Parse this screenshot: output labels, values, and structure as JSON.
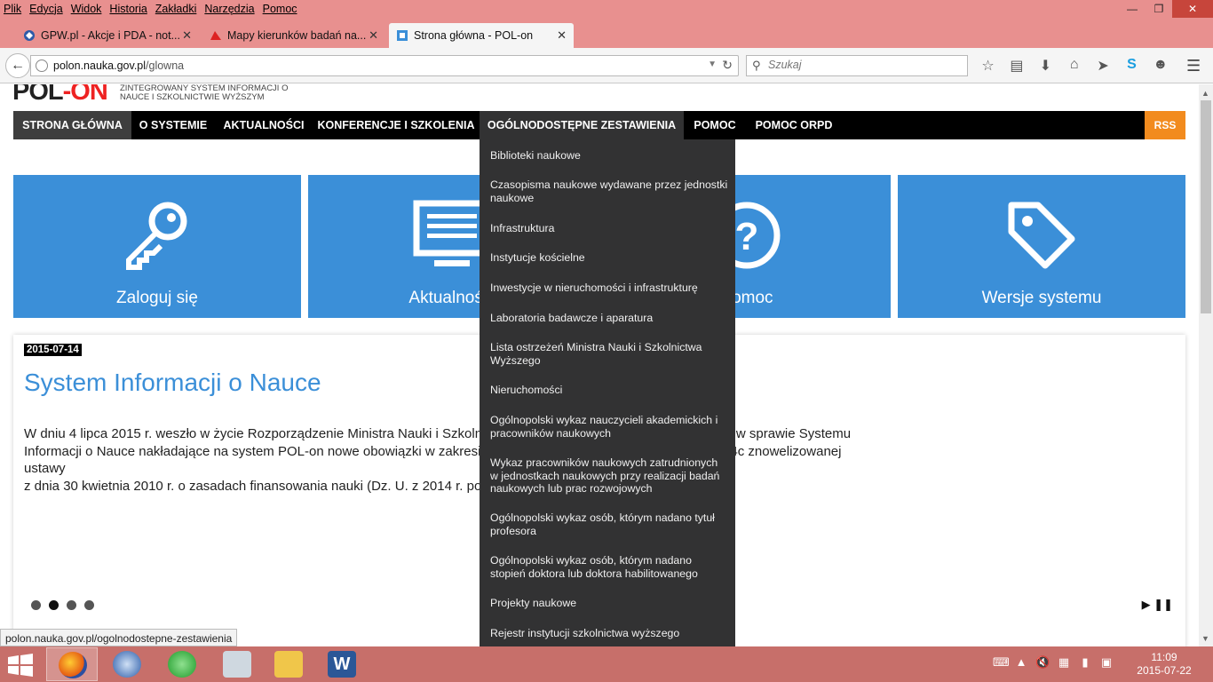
{
  "browser": {
    "menu": [
      "Plik",
      "Edycja",
      "Widok",
      "Historia",
      "Zakładki",
      "Narzędzia",
      "Pomoc"
    ],
    "tabs": [
      {
        "title": "GPW.pl - Akcje i PDA - not..."
      },
      {
        "title": "Mapy kierunków badań na..."
      },
      {
        "title": "Strona główna - POL-on"
      }
    ],
    "url_domain": "polon.nauka.gov.pl",
    "url_path": "/glowna",
    "search_placeholder": "Szukaj",
    "status_url": "polon.nauka.gov.pl/ogolnodostepne-zestawienia"
  },
  "site": {
    "logo_main": "POL",
    "logo_accent": "-ON",
    "logo_caption": "ZINTEGROWANY SYSTEM INFORMACJI O NAUCE I SZKOLNICTWIE WYŻSZYM",
    "nav": [
      {
        "label": "STRONA GŁÓWNA"
      },
      {
        "label": "O SYSTEMIE"
      },
      {
        "label": "AKTUALNOŚCI"
      },
      {
        "label": "KONFERENCJE I SZKOLENIA"
      },
      {
        "label": "OGÓLNODOSTĘPNE ZESTAWIENIA"
      },
      {
        "label": "POMOC"
      },
      {
        "label": "POMOC ORPD"
      }
    ],
    "rss": "RSS",
    "tiles": [
      {
        "label": "Zaloguj się",
        "icon": "key-icon"
      },
      {
        "label": "Aktualności",
        "icon": "monitor-icon"
      },
      {
        "label": "Pomoc",
        "icon": "question-icon"
      },
      {
        "label": "Wersje systemu",
        "icon": "tag-icon"
      }
    ],
    "news": {
      "date": "2015-07-14",
      "title": "System Informacji o Nauce",
      "body_line1": "W dniu 4 lipca 2015 r. weszło w życie Rozporządzenie Ministra Nauki i Szkolnictwa Wyższego z dnia 26 czerwca 2015 r. w sprawie Systemu",
      "body_line2": "Informacji o Nauce nakładające na system POL-on nowe obowiązki w zakresie gromadzenia danych określonych w art. 4c znowelizowanej ustawy",
      "body_line3": "z dnia 30 kwietnia 2010 r. o zasadach finansowania nauki (Dz. U. z 2014 r. poz. 1620 z późn. zm.)."
    },
    "dropdown": [
      "Biblioteki naukowe",
      "Czasopisma naukowe wydawane przez jednostki naukowe",
      "Infrastruktura",
      "Instytucje kościelne",
      "Inwestycje w nieruchomości i infrastrukturę",
      "Laboratoria badawcze i aparatura",
      "Lista ostrzeżeń Ministra Nauki i Szkolnictwa Wyższego",
      "Nieruchomości",
      "Ogólnopolski wykaz nauczycieli akademickich i pracowników naukowych",
      "Wykaz pracowników naukowych zatrudnionych w jednostkach naukowych przy realizacji badań naukowych lub prac rozwojowych",
      "Ogólnopolski wykaz osób, którym nadano tytuł profesora",
      "Ogólnopolski wykaz osób, którym nadano stopień doktora lub doktora habilitowanego",
      "Projekty naukowe",
      "Rejestr instytucji szkolnictwa wyższego"
    ]
  },
  "taskbar": {
    "time": "11:09",
    "date": "2015-07-22"
  },
  "colors": {
    "chrome": "#e8908f",
    "tile_blue": "#3b8fd8",
    "rss_orange": "#f28b1e",
    "taskbar": "#c76f6a"
  }
}
